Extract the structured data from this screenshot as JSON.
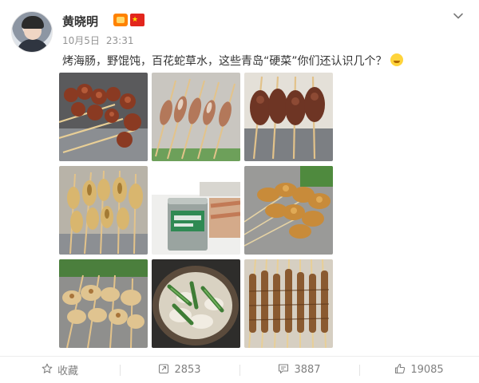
{
  "post": {
    "author": "黄晓明",
    "date": "10月5日",
    "time": "23:31",
    "text": "烤海肠，野馄饨，百花蛇草水，这些青岛“硬菜”你们还认识几个？",
    "photo_count": 9
  },
  "icons": {
    "more": "chevron-down-icon",
    "favorite": "star-icon",
    "repost": "repost-icon",
    "comment": "comment-icon",
    "like": "thumbs-up-icon"
  },
  "actions": {
    "favorite_label": "收藏",
    "repost_count": "2853",
    "comment_count": "3887",
    "like_count": "19085"
  },
  "colors": {
    "text": "#333333",
    "meta": "#939393",
    "action": "#808080",
    "brand_orange": "#ff8200"
  }
}
